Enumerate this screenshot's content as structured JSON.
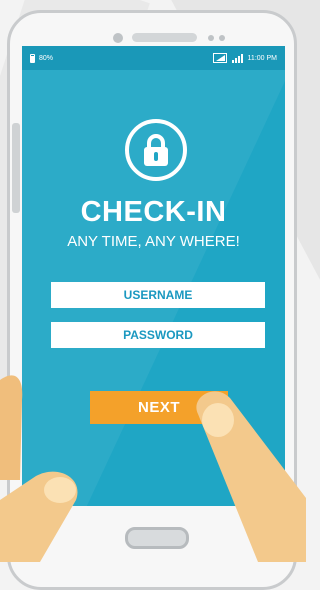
{
  "status_bar": {
    "battery": "80%",
    "time": "11:00 PM"
  },
  "app": {
    "title": "CHECK-IN",
    "subtitle": "ANY TIME, ANY WHERE!"
  },
  "form": {
    "username_placeholder": "USERNAME",
    "password_placeholder": "PASSWORD",
    "next_label": "NEXT"
  },
  "icons": {
    "lock": "lock-icon",
    "battery": "battery-icon",
    "wifi": "wifi-icon",
    "signal": "signal-icon"
  },
  "colors": {
    "screen": "#1fa6c5",
    "status_bar": "#1a98b8",
    "field_text": "#1a98c0",
    "button": "#f4a12a",
    "skin": "#f3c98c"
  }
}
